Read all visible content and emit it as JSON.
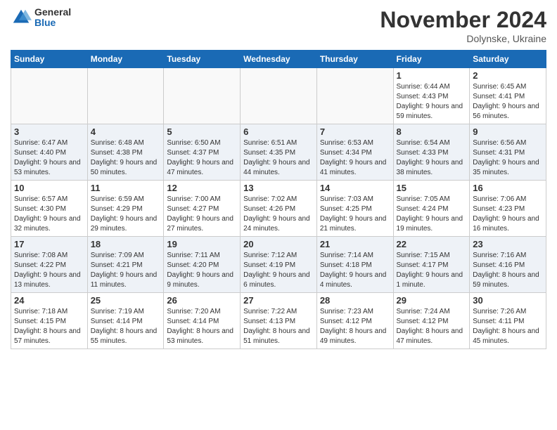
{
  "logo": {
    "general": "General",
    "blue": "Blue"
  },
  "header": {
    "title": "November 2024",
    "location": "Dolynske, Ukraine"
  },
  "days_of_week": [
    "Sunday",
    "Monday",
    "Tuesday",
    "Wednesday",
    "Thursday",
    "Friday",
    "Saturday"
  ],
  "weeks": [
    [
      {
        "day": "",
        "detail": ""
      },
      {
        "day": "",
        "detail": ""
      },
      {
        "day": "",
        "detail": ""
      },
      {
        "day": "",
        "detail": ""
      },
      {
        "day": "",
        "detail": ""
      },
      {
        "day": "1",
        "detail": "Sunrise: 6:44 AM\nSunset: 4:43 PM\nDaylight: 9 hours and 59 minutes."
      },
      {
        "day": "2",
        "detail": "Sunrise: 6:45 AM\nSunset: 4:41 PM\nDaylight: 9 hours and 56 minutes."
      }
    ],
    [
      {
        "day": "3",
        "detail": "Sunrise: 6:47 AM\nSunset: 4:40 PM\nDaylight: 9 hours and 53 minutes."
      },
      {
        "day": "4",
        "detail": "Sunrise: 6:48 AM\nSunset: 4:38 PM\nDaylight: 9 hours and 50 minutes."
      },
      {
        "day": "5",
        "detail": "Sunrise: 6:50 AM\nSunset: 4:37 PM\nDaylight: 9 hours and 47 minutes."
      },
      {
        "day": "6",
        "detail": "Sunrise: 6:51 AM\nSunset: 4:35 PM\nDaylight: 9 hours and 44 minutes."
      },
      {
        "day": "7",
        "detail": "Sunrise: 6:53 AM\nSunset: 4:34 PM\nDaylight: 9 hours and 41 minutes."
      },
      {
        "day": "8",
        "detail": "Sunrise: 6:54 AM\nSunset: 4:33 PM\nDaylight: 9 hours and 38 minutes."
      },
      {
        "day": "9",
        "detail": "Sunrise: 6:56 AM\nSunset: 4:31 PM\nDaylight: 9 hours and 35 minutes."
      }
    ],
    [
      {
        "day": "10",
        "detail": "Sunrise: 6:57 AM\nSunset: 4:30 PM\nDaylight: 9 hours and 32 minutes."
      },
      {
        "day": "11",
        "detail": "Sunrise: 6:59 AM\nSunset: 4:29 PM\nDaylight: 9 hours and 29 minutes."
      },
      {
        "day": "12",
        "detail": "Sunrise: 7:00 AM\nSunset: 4:27 PM\nDaylight: 9 hours and 27 minutes."
      },
      {
        "day": "13",
        "detail": "Sunrise: 7:02 AM\nSunset: 4:26 PM\nDaylight: 9 hours and 24 minutes."
      },
      {
        "day": "14",
        "detail": "Sunrise: 7:03 AM\nSunset: 4:25 PM\nDaylight: 9 hours and 21 minutes."
      },
      {
        "day": "15",
        "detail": "Sunrise: 7:05 AM\nSunset: 4:24 PM\nDaylight: 9 hours and 19 minutes."
      },
      {
        "day": "16",
        "detail": "Sunrise: 7:06 AM\nSunset: 4:23 PM\nDaylight: 9 hours and 16 minutes."
      }
    ],
    [
      {
        "day": "17",
        "detail": "Sunrise: 7:08 AM\nSunset: 4:22 PM\nDaylight: 9 hours and 13 minutes."
      },
      {
        "day": "18",
        "detail": "Sunrise: 7:09 AM\nSunset: 4:21 PM\nDaylight: 9 hours and 11 minutes."
      },
      {
        "day": "19",
        "detail": "Sunrise: 7:11 AM\nSunset: 4:20 PM\nDaylight: 9 hours and 9 minutes."
      },
      {
        "day": "20",
        "detail": "Sunrise: 7:12 AM\nSunset: 4:19 PM\nDaylight: 9 hours and 6 minutes."
      },
      {
        "day": "21",
        "detail": "Sunrise: 7:14 AM\nSunset: 4:18 PM\nDaylight: 9 hours and 4 minutes."
      },
      {
        "day": "22",
        "detail": "Sunrise: 7:15 AM\nSunset: 4:17 PM\nDaylight: 9 hours and 1 minute."
      },
      {
        "day": "23",
        "detail": "Sunrise: 7:16 AM\nSunset: 4:16 PM\nDaylight: 8 hours and 59 minutes."
      }
    ],
    [
      {
        "day": "24",
        "detail": "Sunrise: 7:18 AM\nSunset: 4:15 PM\nDaylight: 8 hours and 57 minutes."
      },
      {
        "day": "25",
        "detail": "Sunrise: 7:19 AM\nSunset: 4:14 PM\nDaylight: 8 hours and 55 minutes."
      },
      {
        "day": "26",
        "detail": "Sunrise: 7:20 AM\nSunset: 4:14 PM\nDaylight: 8 hours and 53 minutes."
      },
      {
        "day": "27",
        "detail": "Sunrise: 7:22 AM\nSunset: 4:13 PM\nDaylight: 8 hours and 51 minutes."
      },
      {
        "day": "28",
        "detail": "Sunrise: 7:23 AM\nSunset: 4:12 PM\nDaylight: 8 hours and 49 minutes."
      },
      {
        "day": "29",
        "detail": "Sunrise: 7:24 AM\nSunset: 4:12 PM\nDaylight: 8 hours and 47 minutes."
      },
      {
        "day": "30",
        "detail": "Sunrise: 7:26 AM\nSunset: 4:11 PM\nDaylight: 8 hours and 45 minutes."
      }
    ]
  ]
}
